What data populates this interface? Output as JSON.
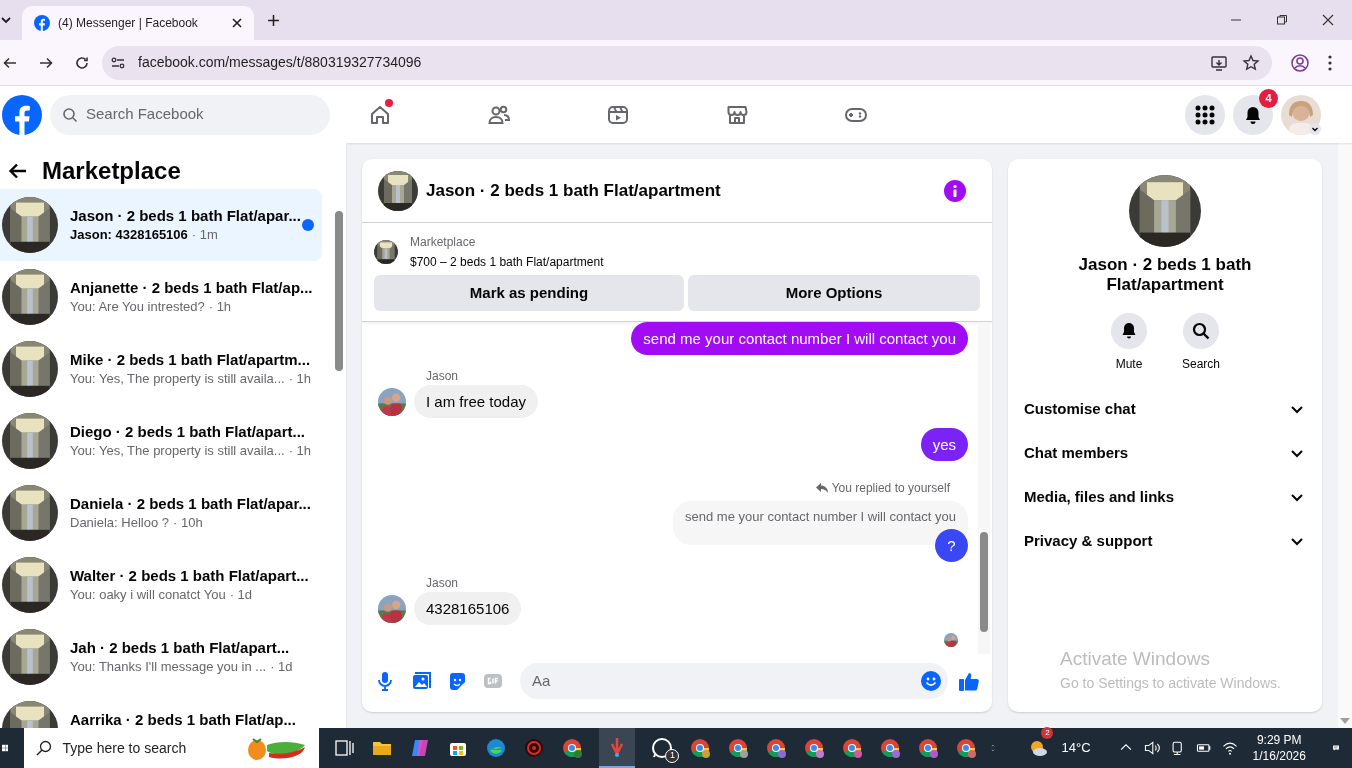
{
  "browser": {
    "tab_title": "(4) Messenger | Facebook",
    "url": "facebook.com/messages/t/880319327734096"
  },
  "topbar": {
    "search_placeholder": "Search Facebook",
    "nav": [
      {
        "kind": "home",
        "dot": true
      },
      {
        "kind": "friends",
        "dot": false
      },
      {
        "kind": "video",
        "dot": false
      },
      {
        "kind": "market",
        "dot": false
      },
      {
        "kind": "gaming",
        "dot": false
      }
    ],
    "notification_count": "4"
  },
  "sidebar": {
    "title": "Marketplace",
    "conversations": [
      {
        "name": "Jason · 2 beds 1 bath Flat/apar...",
        "preview": "Jason: 4328165106",
        "time": "· 1m",
        "selected": true,
        "unread": true
      },
      {
        "name": "Anjanette · 2 beds 1 bath Flat/ap...",
        "preview": "You: Are You intrested?",
        "time": "· 1h",
        "selected": false,
        "unread": false
      },
      {
        "name": "Mike · 2 beds 1 bath Flat/apartm...",
        "preview": "You: Yes, The property is still availa...",
        "time": "· 1h",
        "selected": false,
        "unread": false
      },
      {
        "name": "Diego · 2 beds 1 bath Flat/apart...",
        "preview": "You: Yes, The property is still availa...",
        "time": "· 1h",
        "selected": false,
        "unread": false
      },
      {
        "name": "Daniela · 2 beds 1 bath Flat/apar...",
        "preview": "Daniela: Helloo ?",
        "time": "· 10h",
        "selected": false,
        "unread": false
      },
      {
        "name": "Walter · 2 beds 1 bath Flat/apart...",
        "preview": "You: oaky i will conatct You",
        "time": "· 1d",
        "selected": false,
        "unread": false
      },
      {
        "name": "Jah · 2 beds 1 bath Flat/apart...",
        "preview": "You: Thanks I'll message you in ...",
        "time": "· 1d",
        "selected": false,
        "unread": false
      },
      {
        "name": "Aarrika · 2 beds 1 bath Flat/ap...",
        "selected": false,
        "unread": false
      }
    ]
  },
  "chat": {
    "title": "Jason · 2 beds 1 bath Flat/apartment",
    "listing": {
      "label": "Marketplace",
      "text": "$700 – 2 beds 1 bath Flat/apartment"
    },
    "buttons": [
      "Mark as pending",
      "More Options"
    ],
    "messages": [
      {
        "kind": "outgoing",
        "text": "send me your contact number I will contact you",
        "color": "#a20cf5"
      },
      {
        "kind": "incoming",
        "sender": "Jason",
        "text": "I am free today"
      },
      {
        "kind": "outgoing",
        "text": "yes",
        "color": "#7b22f7"
      },
      {
        "kind": "reply",
        "note": "You replied to yourself",
        "quote": "send me your contact number I will contact you"
      },
      {
        "kind": "outgoing",
        "text": "?",
        "color": "#3a47f5"
      },
      {
        "kind": "incoming",
        "sender": "Jason",
        "text": "4328165106"
      }
    ],
    "composer_placeholder": "Aa"
  },
  "details": {
    "title": "Jason · 2 beds 1 bath Flat/apartment",
    "actions": [
      {
        "kind": "mute",
        "label": "Mute"
      },
      {
        "kind": "search",
        "label": "Search"
      }
    ],
    "sections": [
      {
        "label": "Customise chat",
        "expanded": false
      },
      {
        "label": "Chat members",
        "expanded": false
      },
      {
        "label": "Media, files and links",
        "expanded": false
      },
      {
        "label": "Privacy & support",
        "expanded": false
      }
    ]
  },
  "activation": {
    "title": "Activate Windows",
    "text": "Go to Settings to activate Windows."
  },
  "taskbar": {
    "search_placeholder": "Type here to search",
    "weather_badge": "2",
    "temperature": "14°C",
    "whatsapp_badge": "1",
    "time": "9:29 PM",
    "date": "1/16/2026"
  }
}
